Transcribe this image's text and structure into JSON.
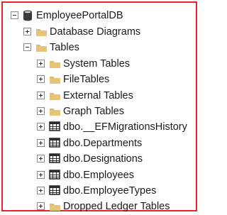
{
  "tree": {
    "root": {
      "label": "EmployeePortalDB",
      "expanded": true,
      "icon": "database-icon"
    },
    "items": [
      {
        "label": "Database Diagrams",
        "expanded": false,
        "icon": "folder-icon"
      },
      {
        "label": "Tables",
        "expanded": true,
        "icon": "folder-icon"
      },
      {
        "label": "System Tables",
        "expanded": false,
        "icon": "folder-icon"
      },
      {
        "label": "FileTables",
        "expanded": false,
        "icon": "folder-icon"
      },
      {
        "label": "External Tables",
        "expanded": false,
        "icon": "folder-icon"
      },
      {
        "label": "Graph Tables",
        "expanded": false,
        "icon": "folder-icon"
      },
      {
        "label": "dbo.__EFMigrationsHistory",
        "expanded": false,
        "icon": "table-icon"
      },
      {
        "label": "dbo.Departments",
        "expanded": false,
        "icon": "table-icon"
      },
      {
        "label": "dbo.Designations",
        "expanded": false,
        "icon": "table-icon"
      },
      {
        "label": "dbo.Employees",
        "expanded": false,
        "icon": "table-icon"
      },
      {
        "label": "dbo.EmployeeTypes",
        "expanded": false,
        "icon": "table-icon"
      },
      {
        "label": "Dropped Ledger Tables",
        "expanded": false,
        "icon": "folder-icon"
      }
    ]
  },
  "colors": {
    "border": "#e8242c",
    "folder": "#dcb96a",
    "database": "#3a3a3a",
    "table": "#2b2b2b"
  }
}
